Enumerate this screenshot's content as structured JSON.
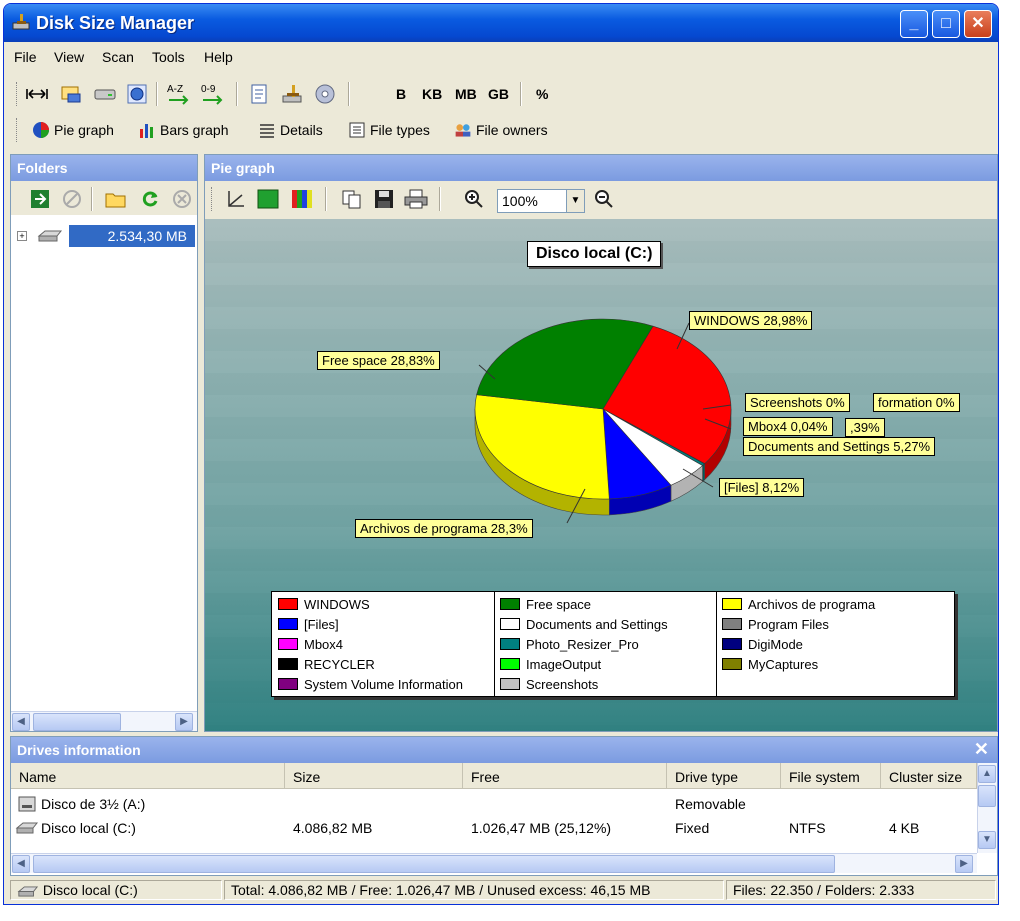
{
  "window": {
    "title": "Disk Size Manager",
    "title_icon": "disk-broom-icon",
    "minimize": "_",
    "maximize": "□",
    "close": "✕"
  },
  "menu": [
    "File",
    "View",
    "Scan",
    "Tools",
    "Help"
  ],
  "toolbar": {
    "icons": [
      "expand-width-icon",
      "select-folder-icon",
      "drive-icon",
      "refresh-globe-icon",
      "sort-az-icon",
      "sort-09-icon",
      "report-icon",
      "cleanup-icon",
      "settings-disc-icon"
    ],
    "sort_az": "A-Z",
    "sort_09": "0-9",
    "units": [
      "B",
      "KB",
      "MB",
      "GB"
    ],
    "active_unit": "MB",
    "percent": "%"
  },
  "views": [
    "Pie graph",
    "Bars graph",
    "Details",
    "File types",
    "File owners"
  ],
  "folders": {
    "header": "Folders",
    "tree_root": "2.534,30 MB",
    "tools": [
      "go-icon",
      "stop-icon",
      "open-folder-icon",
      "refresh-icon",
      "cancel-icon"
    ]
  },
  "graph_panel": {
    "header": "Pie graph",
    "zoom": "100%"
  },
  "chart_data": {
    "type": "pie",
    "title": "Disco local (C:)",
    "slices": [
      {
        "name": "WINDOWS",
        "value": 28.98,
        "label": "WINDOWS 28,98%",
        "color": "#ff0000"
      },
      {
        "name": "System Volume Information",
        "value": 0.0,
        "label": "formation 0%",
        "color": "#800080"
      },
      {
        "name": "Screenshots",
        "value": 0.0,
        "label": "Screenshots 0%",
        "color": "#c0c0c0"
      },
      {
        "name": "Mbox4",
        "value": 0.04,
        "label": "Mbox4 0,04%",
        "color": "#ff00ff"
      },
      {
        "name": "Photo_Resizer_Pro",
        "value": 0.39,
        "label": ",39%",
        "color": "#008080"
      },
      {
        "name": "Documents and Settings",
        "value": 5.27,
        "label": "Documents and Settings 5,27%",
        "color": "#ffffff"
      },
      {
        "name": "[Files]",
        "value": 8.12,
        "label": "[Files] 8,12%",
        "color": "#0000ff"
      },
      {
        "name": "Archivos de programa",
        "value": 28.3,
        "label": "Archivos de programa 28,3%",
        "color": "#ffff00"
      },
      {
        "name": "Free space",
        "value": 28.83,
        "label": "Free space 28,83%",
        "color": "#008000"
      }
    ],
    "legend": [
      {
        "name": "WINDOWS",
        "color": "#ff0000"
      },
      {
        "name": "[Files]",
        "color": "#0000ff"
      },
      {
        "name": "Mbox4",
        "color": "#ff00ff"
      },
      {
        "name": "RECYCLER",
        "color": "#000000"
      },
      {
        "name": "System Volume Information",
        "color": "#800080"
      },
      {
        "name": "Free space",
        "color": "#008000"
      },
      {
        "name": "Documents and Settings",
        "color": "#ffffff"
      },
      {
        "name": "Photo_Resizer_Pro",
        "color": "#008080"
      },
      {
        "name": "ImageOutput",
        "color": "#00ff00"
      },
      {
        "name": "Screenshots",
        "color": "#c0c0c0"
      },
      {
        "name": "Archivos de programa",
        "color": "#ffff00"
      },
      {
        "name": "Program Files",
        "color": "#808080"
      },
      {
        "name": "DigiMode",
        "color": "#000080"
      },
      {
        "name": "MyCaptures",
        "color": "#808000"
      }
    ]
  },
  "drives": {
    "header": "Drives information",
    "columns": [
      "Name",
      "Size",
      "Free",
      "Drive type",
      "File system",
      "Cluster size"
    ],
    "rows": [
      {
        "name": "Disco de 3½ (A:)",
        "size": "",
        "free": "",
        "type": "Removable",
        "fs": "",
        "cluster": ""
      },
      {
        "name": "Disco local (C:)",
        "size": "4.086,82 MB",
        "free": "1.026,47 MB (25,12%)",
        "type": "Fixed",
        "fs": "NTFS",
        "cluster": "4 KB"
      }
    ]
  },
  "status": {
    "drive": "Disco local (C:)",
    "totals": "Total: 4.086,82 MB / Free: 1.026,47 MB / Unused excess: 46,15 MB",
    "counts": "Files: 22.350 / Folders: 2.333"
  }
}
